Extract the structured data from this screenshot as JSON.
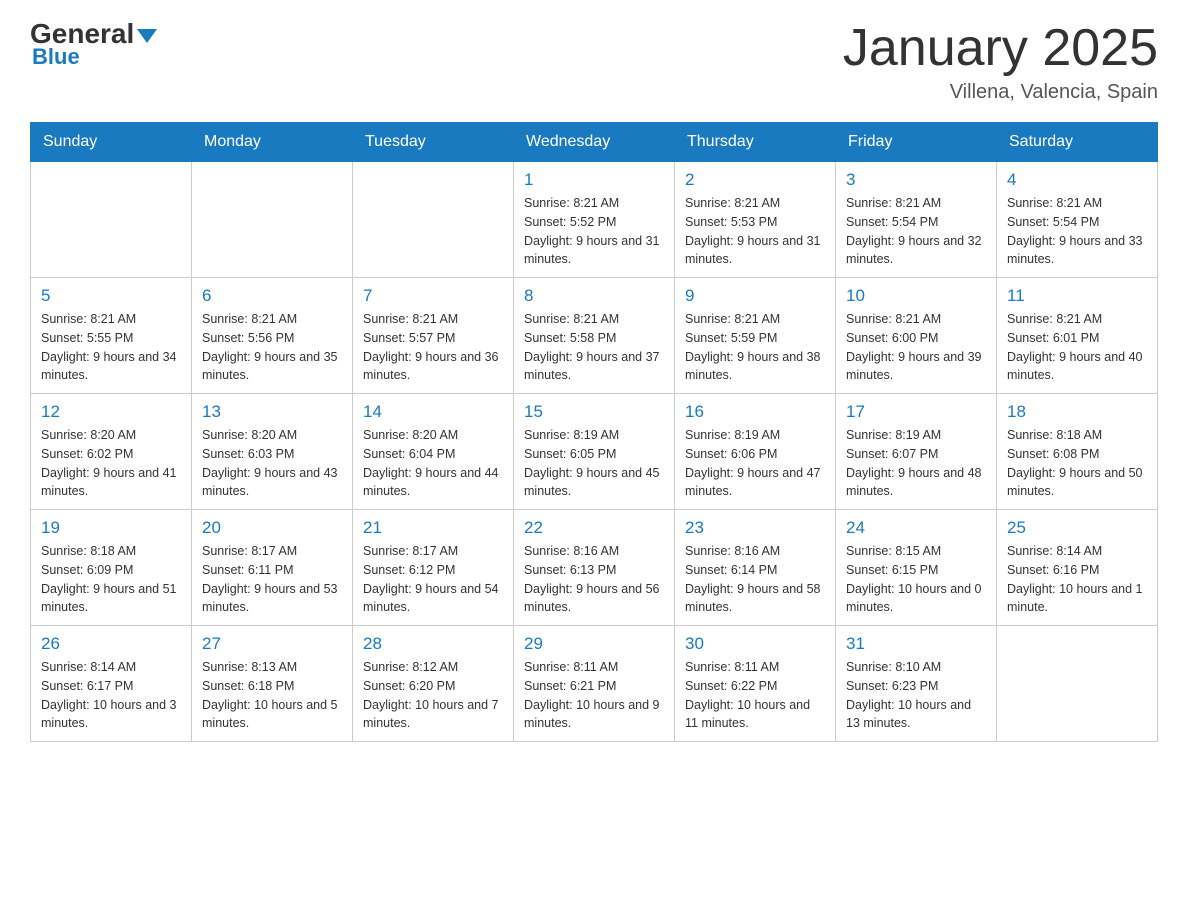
{
  "header": {
    "logo_general": "General",
    "logo_blue": "Blue",
    "month_title": "January 2025",
    "location": "Villena, Valencia, Spain"
  },
  "days_of_week": [
    "Sunday",
    "Monday",
    "Tuesday",
    "Wednesday",
    "Thursday",
    "Friday",
    "Saturday"
  ],
  "weeks": [
    [
      {
        "day": "",
        "info": ""
      },
      {
        "day": "",
        "info": ""
      },
      {
        "day": "",
        "info": ""
      },
      {
        "day": "1",
        "info": "Sunrise: 8:21 AM\nSunset: 5:52 PM\nDaylight: 9 hours and 31 minutes."
      },
      {
        "day": "2",
        "info": "Sunrise: 8:21 AM\nSunset: 5:53 PM\nDaylight: 9 hours and 31 minutes."
      },
      {
        "day": "3",
        "info": "Sunrise: 8:21 AM\nSunset: 5:54 PM\nDaylight: 9 hours and 32 minutes."
      },
      {
        "day": "4",
        "info": "Sunrise: 8:21 AM\nSunset: 5:54 PM\nDaylight: 9 hours and 33 minutes."
      }
    ],
    [
      {
        "day": "5",
        "info": "Sunrise: 8:21 AM\nSunset: 5:55 PM\nDaylight: 9 hours and 34 minutes."
      },
      {
        "day": "6",
        "info": "Sunrise: 8:21 AM\nSunset: 5:56 PM\nDaylight: 9 hours and 35 minutes."
      },
      {
        "day": "7",
        "info": "Sunrise: 8:21 AM\nSunset: 5:57 PM\nDaylight: 9 hours and 36 minutes."
      },
      {
        "day": "8",
        "info": "Sunrise: 8:21 AM\nSunset: 5:58 PM\nDaylight: 9 hours and 37 minutes."
      },
      {
        "day": "9",
        "info": "Sunrise: 8:21 AM\nSunset: 5:59 PM\nDaylight: 9 hours and 38 minutes."
      },
      {
        "day": "10",
        "info": "Sunrise: 8:21 AM\nSunset: 6:00 PM\nDaylight: 9 hours and 39 minutes."
      },
      {
        "day": "11",
        "info": "Sunrise: 8:21 AM\nSunset: 6:01 PM\nDaylight: 9 hours and 40 minutes."
      }
    ],
    [
      {
        "day": "12",
        "info": "Sunrise: 8:20 AM\nSunset: 6:02 PM\nDaylight: 9 hours and 41 minutes."
      },
      {
        "day": "13",
        "info": "Sunrise: 8:20 AM\nSunset: 6:03 PM\nDaylight: 9 hours and 43 minutes."
      },
      {
        "day": "14",
        "info": "Sunrise: 8:20 AM\nSunset: 6:04 PM\nDaylight: 9 hours and 44 minutes."
      },
      {
        "day": "15",
        "info": "Sunrise: 8:19 AM\nSunset: 6:05 PM\nDaylight: 9 hours and 45 minutes."
      },
      {
        "day": "16",
        "info": "Sunrise: 8:19 AM\nSunset: 6:06 PM\nDaylight: 9 hours and 47 minutes."
      },
      {
        "day": "17",
        "info": "Sunrise: 8:19 AM\nSunset: 6:07 PM\nDaylight: 9 hours and 48 minutes."
      },
      {
        "day": "18",
        "info": "Sunrise: 8:18 AM\nSunset: 6:08 PM\nDaylight: 9 hours and 50 minutes."
      }
    ],
    [
      {
        "day": "19",
        "info": "Sunrise: 8:18 AM\nSunset: 6:09 PM\nDaylight: 9 hours and 51 minutes."
      },
      {
        "day": "20",
        "info": "Sunrise: 8:17 AM\nSunset: 6:11 PM\nDaylight: 9 hours and 53 minutes."
      },
      {
        "day": "21",
        "info": "Sunrise: 8:17 AM\nSunset: 6:12 PM\nDaylight: 9 hours and 54 minutes."
      },
      {
        "day": "22",
        "info": "Sunrise: 8:16 AM\nSunset: 6:13 PM\nDaylight: 9 hours and 56 minutes."
      },
      {
        "day": "23",
        "info": "Sunrise: 8:16 AM\nSunset: 6:14 PM\nDaylight: 9 hours and 58 minutes."
      },
      {
        "day": "24",
        "info": "Sunrise: 8:15 AM\nSunset: 6:15 PM\nDaylight: 10 hours and 0 minutes."
      },
      {
        "day": "25",
        "info": "Sunrise: 8:14 AM\nSunset: 6:16 PM\nDaylight: 10 hours and 1 minute."
      }
    ],
    [
      {
        "day": "26",
        "info": "Sunrise: 8:14 AM\nSunset: 6:17 PM\nDaylight: 10 hours and 3 minutes."
      },
      {
        "day": "27",
        "info": "Sunrise: 8:13 AM\nSunset: 6:18 PM\nDaylight: 10 hours and 5 minutes."
      },
      {
        "day": "28",
        "info": "Sunrise: 8:12 AM\nSunset: 6:20 PM\nDaylight: 10 hours and 7 minutes."
      },
      {
        "day": "29",
        "info": "Sunrise: 8:11 AM\nSunset: 6:21 PM\nDaylight: 10 hours and 9 minutes."
      },
      {
        "day": "30",
        "info": "Sunrise: 8:11 AM\nSunset: 6:22 PM\nDaylight: 10 hours and 11 minutes."
      },
      {
        "day": "31",
        "info": "Sunrise: 8:10 AM\nSunset: 6:23 PM\nDaylight: 10 hours and 13 minutes."
      },
      {
        "day": "",
        "info": ""
      }
    ]
  ]
}
